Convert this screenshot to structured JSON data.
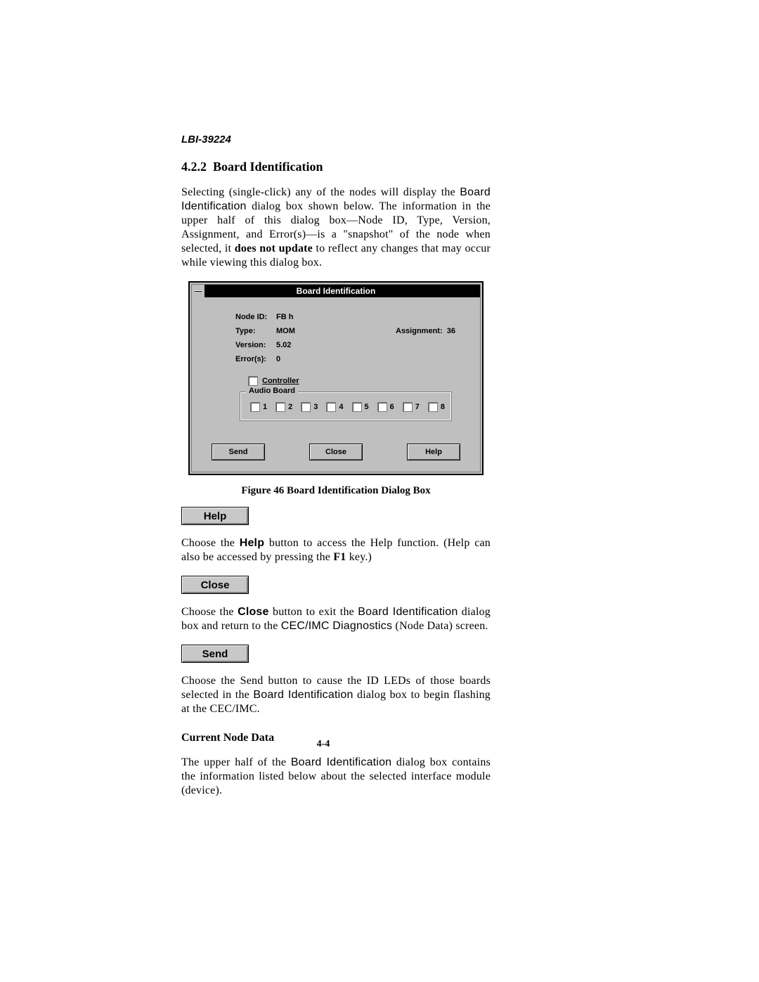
{
  "header": {
    "doc_id": "LBI-39224"
  },
  "section": {
    "number": "4.2.2",
    "title": "Board Identification",
    "paragraph": {
      "seg1": "Selecting (single-click) any of the nodes will display the ",
      "dialog_name": "Board Identification",
      "seg2": " dialog box shown below.  The information in the upper half of this dialog box—Node ID, Type, Version, Assignment, and Error(s)—is a \"snapshot\" of the node when selected, it ",
      "bold1": "does not update",
      "seg3": " to reflect any changes that may occur while viewing this dialog box."
    }
  },
  "dialog": {
    "title": "Board Identification",
    "info": {
      "node_id": {
        "label": "Node ID:",
        "value": "FB  h"
      },
      "type": {
        "label": "Type:",
        "value": "MOM"
      },
      "version": {
        "label": "Version:",
        "value": "5.02"
      },
      "errors": {
        "label": "Error(s):",
        "value": "0"
      },
      "assignment": {
        "label": "Assignment:",
        "value": "36"
      }
    },
    "controller_label": "Controller",
    "audio_board": {
      "legend": "Audio Board",
      "items": [
        "1",
        "2",
        "3",
        "4",
        "5",
        "6",
        "7",
        "8"
      ]
    },
    "buttons": {
      "send": "Send",
      "close": "Close",
      "help": "Help"
    }
  },
  "figure": {
    "caption": "Figure 46  Board Identification Dialog Box"
  },
  "help": {
    "btn": "Help",
    "p": {
      "seg1": "Choose the ",
      "bold": "Help",
      "seg2": " button to access the Help function. (Help can also be accessed by pressing the ",
      "bold2": "F1",
      "seg3": " key.)"
    }
  },
  "close": {
    "btn": "Close",
    "p": {
      "seg1": "Choose the ",
      "bold": "Close",
      "seg2": " button to exit the ",
      "name": "Board Identification",
      "seg3": " dialog box and return to the ",
      "name2": "CEC/IMC Diagnostics",
      "seg4": " (Node Data) screen."
    }
  },
  "send": {
    "btn": "Send",
    "p": {
      "seg1": "Choose the Send button to cause the ID LEDs of those boards selected in the ",
      "name": "Board Identification",
      "seg2": " dialog box to begin flashing at the CEC/IMC."
    }
  },
  "current_node": {
    "title": "Current Node Data",
    "p": {
      "seg1": "The upper half of the ",
      "name": "Board Identification",
      "seg2": " dialog box contains the information listed below about the selected interface module (device)."
    }
  },
  "page_number": "4-4"
}
